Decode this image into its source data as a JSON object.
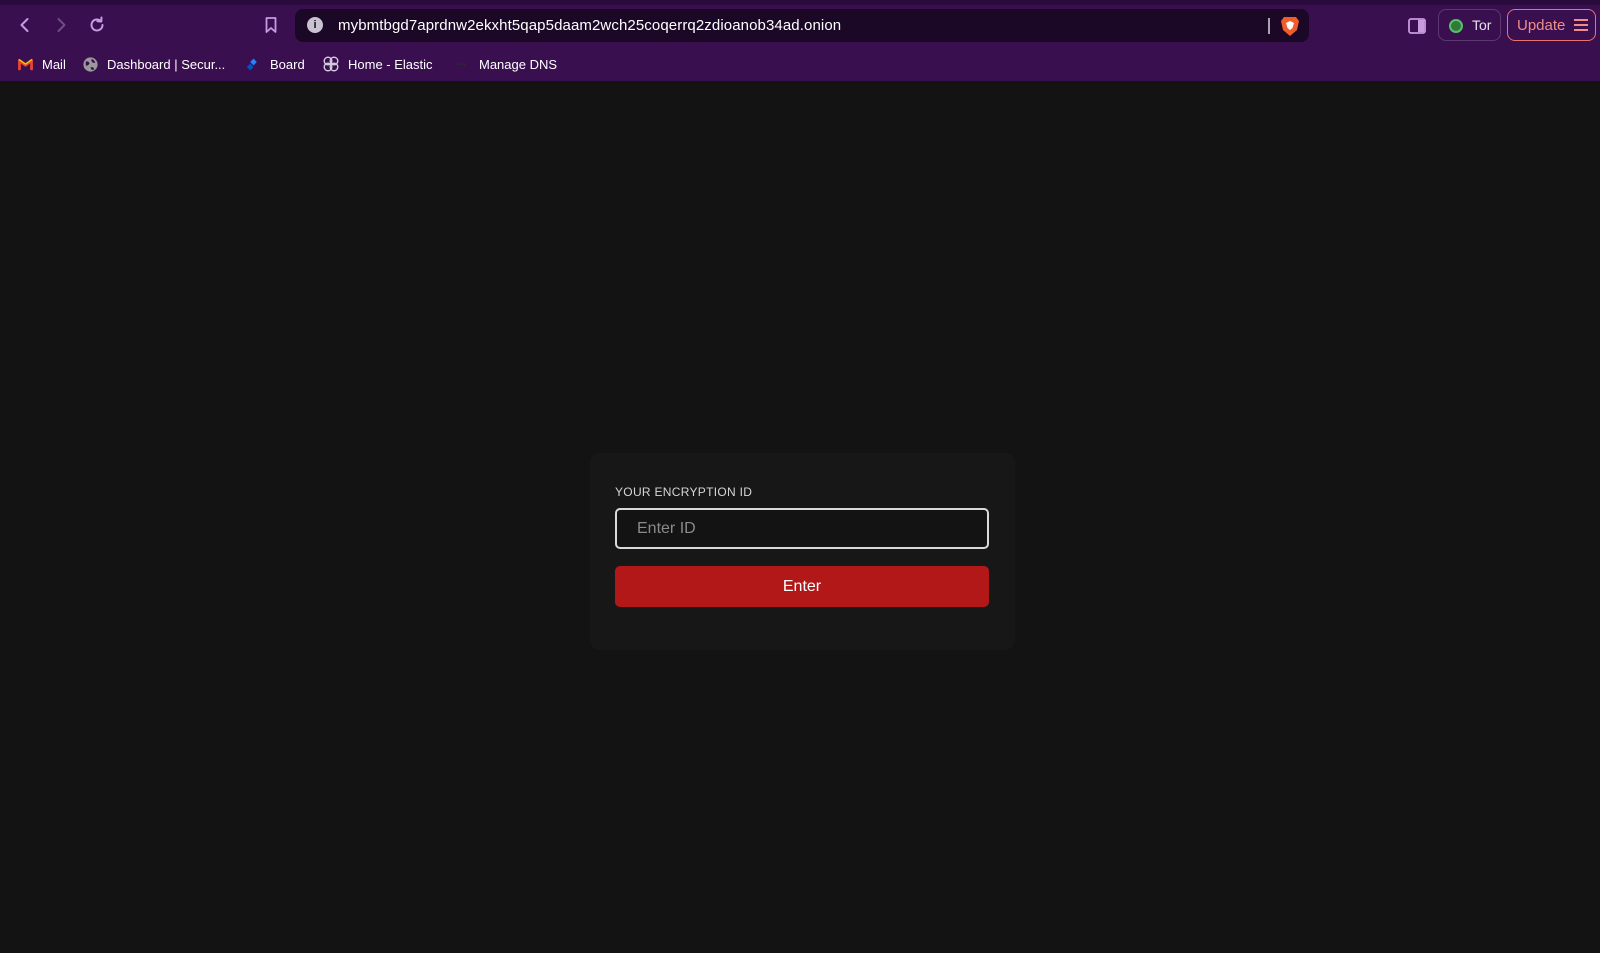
{
  "browser": {
    "url": "mybmtbgd7aprdnw2ekxht5qap5daam2wch25coqerrq2zdioanob34ad.onion",
    "url_info_glyph": "i",
    "tor_label": "Tor",
    "update_label": "Update",
    "colors": {
      "chrome_bg": "#3a0f50",
      "urlbar_bg": "#1a0826",
      "update_accent": "#f08d87",
      "tor_green": "#5bbf6a"
    }
  },
  "bookmarks": [
    {
      "label": "Mail",
      "icon": "gmail-icon"
    },
    {
      "label": "Dashboard | Secur...",
      "icon": "globe-icon"
    },
    {
      "label": "Board",
      "icon": "jira-icon"
    },
    {
      "label": "Home - Elastic",
      "icon": "elastic-icon"
    },
    {
      "label": "Manage DNS",
      "icon": "dns-icon"
    }
  ],
  "form": {
    "label": "YOUR ENCRYPTION ID",
    "input_placeholder": "Enter ID",
    "input_value": "",
    "button_label": "Enter",
    "colors": {
      "page_bg": "#131313",
      "card_bg": "#171718",
      "button_bg": "#b31818"
    }
  }
}
